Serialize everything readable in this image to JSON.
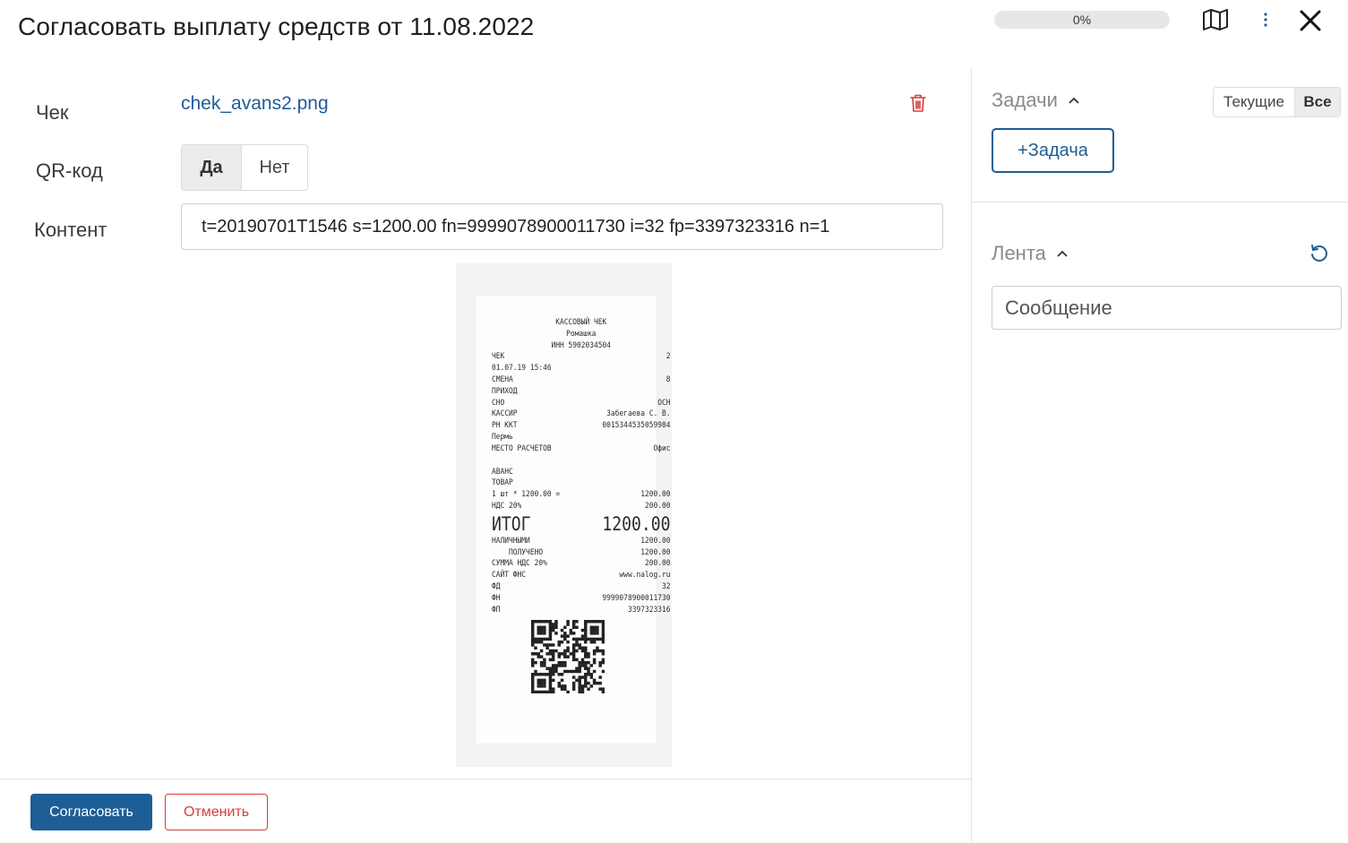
{
  "header": {
    "title": "Согласовать выплату средств от 11.08.2022",
    "progress_label": "0%",
    "icons": [
      "map-icon",
      "more-vertical-icon",
      "close-icon"
    ]
  },
  "form": {
    "check_label": "Чек",
    "file_name": "chek_avans2.png",
    "qr_label": "QR-код",
    "qr_options": {
      "yes": "Да",
      "no": "Нет",
      "selected": "Да"
    },
    "content_label": "Контент",
    "content_value": "t=20190701T1546 s=1200.00 fn=9999078900011730 i=32 fp=3397323316 n=1"
  },
  "receipt": {
    "header_lines": [
      "КАССОВЫЙ ЧЕК",
      "Ромашка",
      "ИНН 5902034504"
    ],
    "rows_top": [
      [
        "ЧЕК",
        "2"
      ],
      [
        "01.07.19 15:46",
        ""
      ],
      [
        "СМЕНА",
        "8"
      ],
      [
        "ПРИХОД",
        ""
      ],
      [
        "СНО",
        "ОСН"
      ],
      [
        "КАССИР",
        "Забегаева С. В."
      ],
      [
        "РН ККТ",
        "0015344535059984"
      ],
      [
        "Пермь",
        ""
      ],
      [
        "МЕСТО РАСЧЕТОВ",
        "Офис"
      ]
    ],
    "rows_mid": [
      [
        "АВАНС",
        ""
      ],
      [
        "ТОВАР",
        ""
      ],
      [
        "1 шт * 1200.00 =",
        "1200.00"
      ],
      [
        "НДС 20%",
        "200.00"
      ]
    ],
    "total_label": "ИТОГ",
    "total_value": "1200.00",
    "rows_bottom": [
      [
        "НАЛИЧНЫМИ",
        "1200.00"
      ],
      [
        "    ПОЛУЧЕНО",
        "1200.00"
      ],
      [
        "СУММА НДС 20%",
        "200.00"
      ],
      [
        "САЙТ ФНС",
        "www.nalog.ru"
      ],
      [
        "ФД",
        "32"
      ],
      [
        "ФН",
        "9999078900011730"
      ],
      [
        "ФП",
        "3397323316"
      ]
    ]
  },
  "footer": {
    "approve_label": "Согласовать",
    "cancel_label": "Отменить"
  },
  "sidebar": {
    "tasks_title": "Задачи",
    "filter_current": "Текущие",
    "filter_all": "Все",
    "filter_selected": "Все",
    "add_task_label": "+Задача",
    "feed_title": "Лента",
    "message_placeholder": "Сообщение"
  },
  "colors": {
    "primary": "#1d5e96",
    "danger": "#d43d3d",
    "link": "#1f5c9a",
    "muted": "#8a8a8a"
  }
}
